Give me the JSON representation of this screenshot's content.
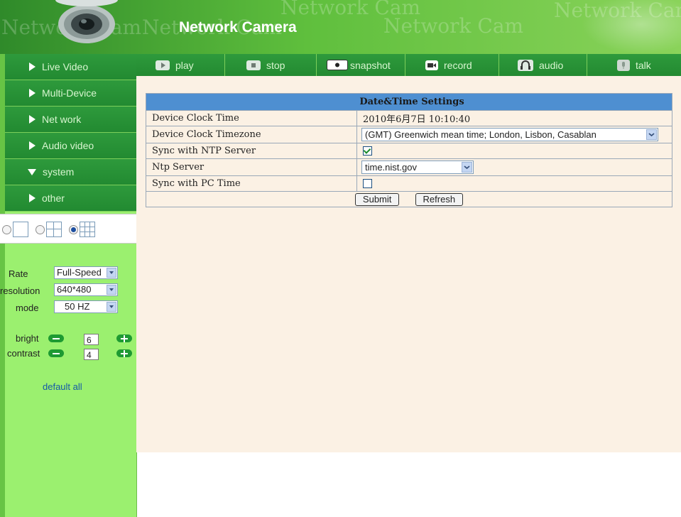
{
  "header": {
    "title": "Network Camera",
    "watermarks": [
      "Network Cam",
      "Network Cam",
      "Network Cam",
      "Network Cam",
      "Network Cam"
    ]
  },
  "sidebar": {
    "menu": [
      {
        "label": "Live Video",
        "expanded": false
      },
      {
        "label": "Multi-Device",
        "expanded": false
      },
      {
        "label": "Net work",
        "expanded": false
      },
      {
        "label": "Audio video",
        "expanded": false
      },
      {
        "label": "system",
        "expanded": true
      },
      {
        "label": "other",
        "expanded": false
      }
    ],
    "layout_selected": "9-view",
    "controls": {
      "rate_label": "Rate",
      "rate_value": "Full-Speed",
      "resolution_label": "resolution",
      "resolution_value": "640*480",
      "mode_label": "mode",
      "mode_value": "50 HZ",
      "bright_label": "bright",
      "bright_value": "6",
      "contrast_label": "contrast",
      "contrast_value": "4",
      "default_all": "default all"
    }
  },
  "toolbar": {
    "buttons": [
      {
        "label": "play",
        "icon": "play-icon"
      },
      {
        "label": "stop",
        "icon": "stop-icon"
      },
      {
        "label": "snapshot",
        "icon": "camera-icon"
      },
      {
        "label": "record",
        "icon": "video-camera-icon"
      },
      {
        "label": "audio",
        "icon": "headphones-icon"
      },
      {
        "label": "talk",
        "icon": "microphone-icon"
      }
    ]
  },
  "settings": {
    "heading": "Date&Time Settings",
    "rows": {
      "clock_label": "Device Clock Time",
      "clock_value": "2010年6月7日  10:10:40",
      "timezone_label": "Device Clock Timezone",
      "timezone_value": "(GMT) Greenwich mean time; London, Lisbon, Casablan",
      "sync_ntp_label": "Sync with NTP Server",
      "sync_ntp_checked": true,
      "ntp_server_label": "Ntp Server",
      "ntp_server_value": "time.nist.gov",
      "sync_pc_label": "Sync with PC Time",
      "sync_pc_checked": false
    },
    "submit_label": "Submit",
    "refresh_label": "Refresh"
  },
  "colors": {
    "menu_green": "#238a31",
    "sidebar_bg": "#9bf06f",
    "content_bg": "#fbf1e4",
    "header_blue": "#4e8fd1"
  }
}
